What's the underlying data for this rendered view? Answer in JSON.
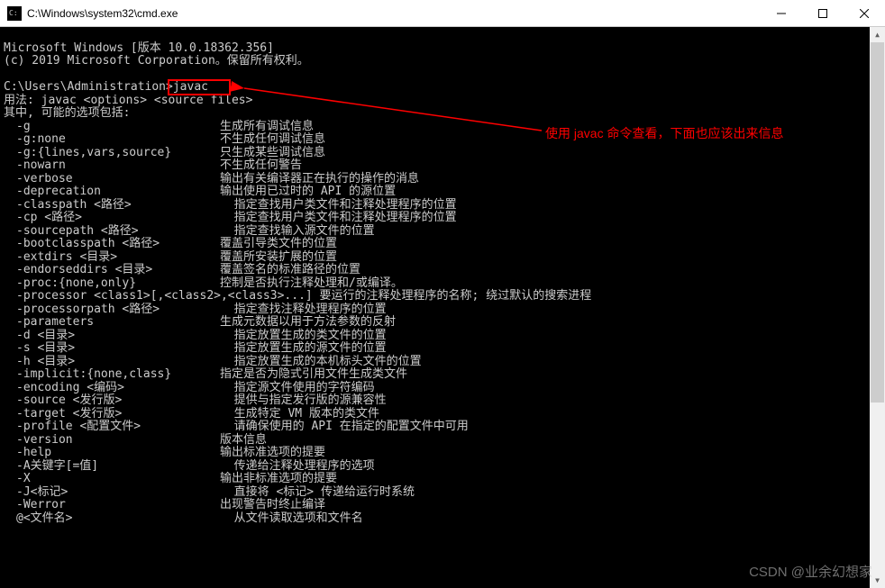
{
  "window": {
    "title": "C:\\Windows\\system32\\cmd.exe"
  },
  "header": {
    "line1": "Microsoft Windows [版本 10.0.18362.356]",
    "line2": "(c) 2019 Microsoft Corporation。保留所有权利。"
  },
  "prompt": {
    "path": "C:\\Users\\Administration>",
    "command": "javac"
  },
  "usage": {
    "line1": "用法: javac <options> <source files>",
    "line2": "其中, 可能的选项包括:"
  },
  "options": [
    {
      "flag": "-g",
      "desc": "生成所有调试信息"
    },
    {
      "flag": "-g:none",
      "desc": "不生成任何调试信息"
    },
    {
      "flag": "-g:{lines,vars,source}",
      "desc": "只生成某些调试信息"
    },
    {
      "flag": "-nowarn",
      "desc": "不生成任何警告"
    },
    {
      "flag": "-verbose",
      "desc": "输出有关编译器正在执行的操作的消息"
    },
    {
      "flag": "-deprecation",
      "desc": "输出使用已过时的 API 的源位置"
    },
    {
      "flag": "-classpath <路径>",
      "desc": "  指定查找用户类文件和注释处理程序的位置"
    },
    {
      "flag": "-cp <路径>",
      "desc": "  指定查找用户类文件和注释处理程序的位置"
    },
    {
      "flag": "-sourcepath <路径>",
      "desc": "  指定查找输入源文件的位置"
    },
    {
      "flag": "-bootclasspath <路径>",
      "desc": "覆盖引导类文件的位置"
    },
    {
      "flag": "-extdirs <目录>",
      "desc": "覆盖所安装扩展的位置"
    },
    {
      "flag": "-endorseddirs <目录>",
      "desc": "覆盖签名的标准路径的位置"
    },
    {
      "flag": "-proc:{none,only}",
      "desc": "控制是否执行注释处理和/或编译。"
    },
    {
      "flag": "-processor <class1>[,<class2>,<class3>...] 要运行的注释处理程序的名称; 绕过默认的搜索进程",
      "desc": ""
    },
    {
      "flag": "-processorpath <路径>",
      "desc": "  指定查找注释处理程序的位置"
    },
    {
      "flag": "-parameters",
      "desc": "生成元数据以用于方法参数的反射"
    },
    {
      "flag": "-d <目录>",
      "desc": "  指定放置生成的类文件的位置"
    },
    {
      "flag": "-s <目录>",
      "desc": "  指定放置生成的源文件的位置"
    },
    {
      "flag": "-h <目录>",
      "desc": "  指定放置生成的本机标头文件的位置"
    },
    {
      "flag": "-implicit:{none,class}",
      "desc": "指定是否为隐式引用文件生成类文件"
    },
    {
      "flag": "-encoding <编码>",
      "desc": "  指定源文件使用的字符编码"
    },
    {
      "flag": "-source <发行版>",
      "desc": "  提供与指定发行版的源兼容性"
    },
    {
      "flag": "-target <发行版>",
      "desc": "  生成特定 VM 版本的类文件"
    },
    {
      "flag": "-profile <配置文件>",
      "desc": "  请确保使用的 API 在指定的配置文件中可用"
    },
    {
      "flag": "-version",
      "desc": "版本信息"
    },
    {
      "flag": "-help",
      "desc": "输出标准选项的提要"
    },
    {
      "flag": "-A关键字[=值]",
      "desc": "  传递给注释处理程序的选项"
    },
    {
      "flag": "-X",
      "desc": "输出非标准选项的提要"
    },
    {
      "flag": "-J<标记>",
      "desc": "  直接将 <标记> 传递给运行时系统"
    },
    {
      "flag": "-Werror",
      "desc": "出现警告时终止编译"
    },
    {
      "flag": "@<文件名>",
      "desc": "  从文件读取选项和文件名"
    }
  ],
  "annotation": {
    "text": "使用 javac 命令查看，下面也应该出来信息"
  },
  "watermark": "CSDN @业余幻想家"
}
